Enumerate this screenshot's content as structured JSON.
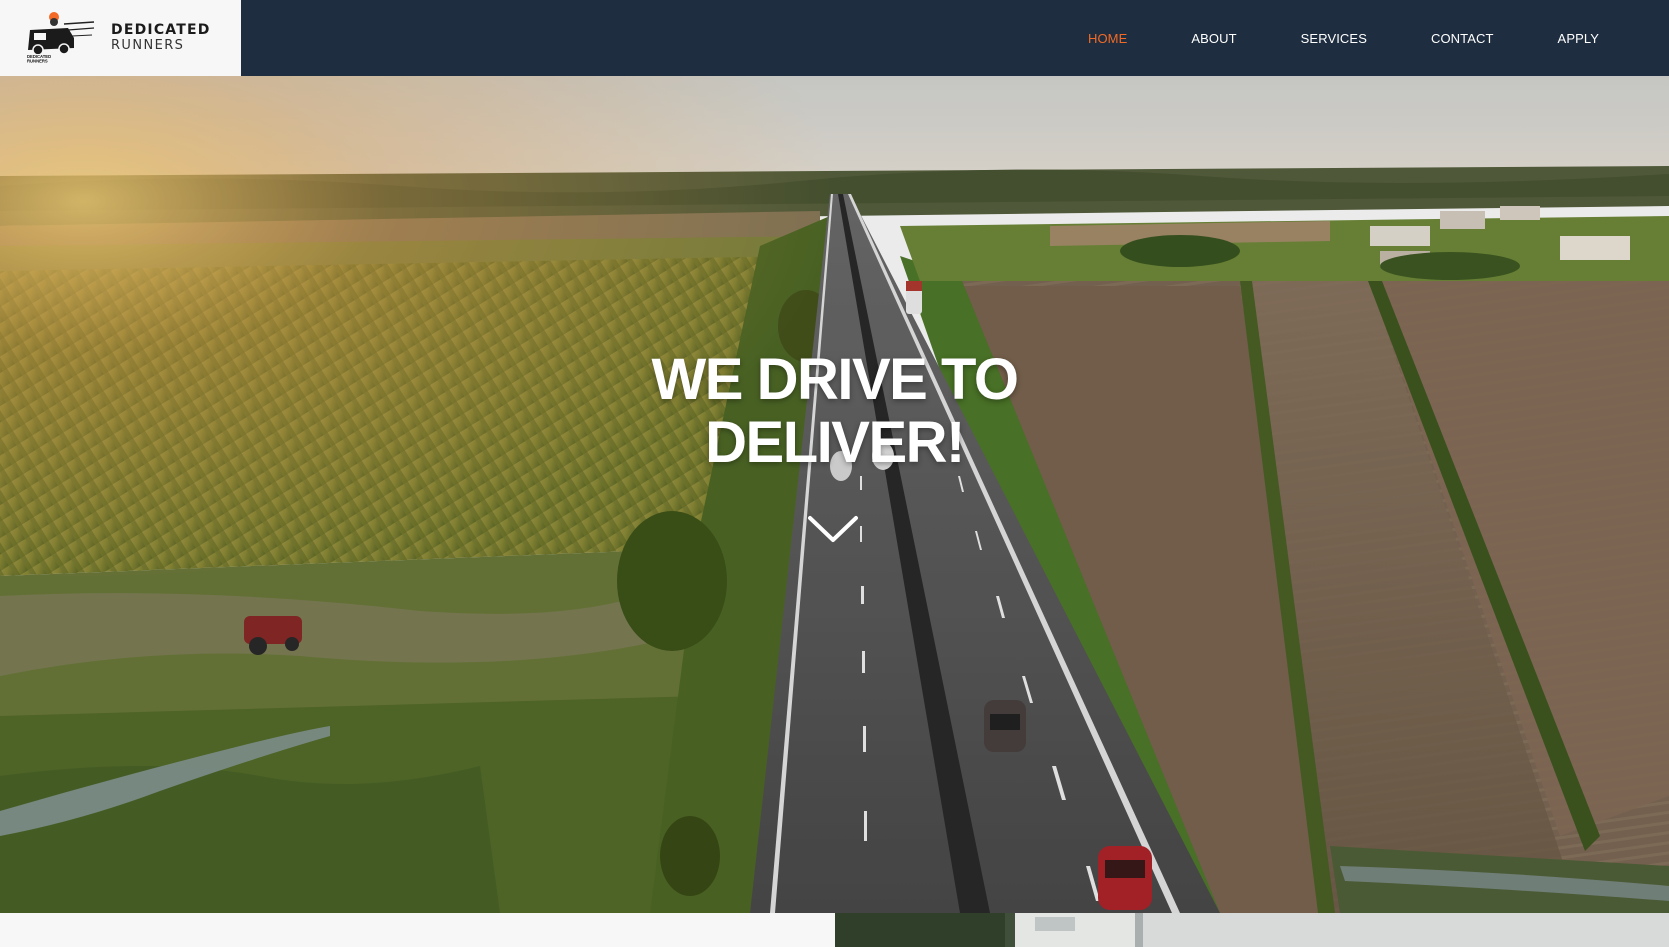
{
  "brand": {
    "name_line1": "DEDICATED",
    "name_line2": "RUNNERS",
    "logo_badge_text": "DEDICATED RUNNERS"
  },
  "nav": {
    "items": [
      {
        "label": "HOME",
        "active": true
      },
      {
        "label": "ABOUT",
        "active": false
      },
      {
        "label": "SERVICES",
        "active": false
      },
      {
        "label": "CONTACT",
        "active": false
      },
      {
        "label": "APPLY",
        "active": false
      }
    ]
  },
  "hero": {
    "headline_line1": "WE DRIVE TO",
    "headline_line2": "DELIVER!",
    "scroll_icon": "chevron-down-icon"
  },
  "colors": {
    "header_bg": "#1e2d40",
    "logo_bg": "#f7f7f7",
    "nav_active": "#f26a25",
    "nav_text": "#ffffff",
    "headline": "#ffffff"
  }
}
